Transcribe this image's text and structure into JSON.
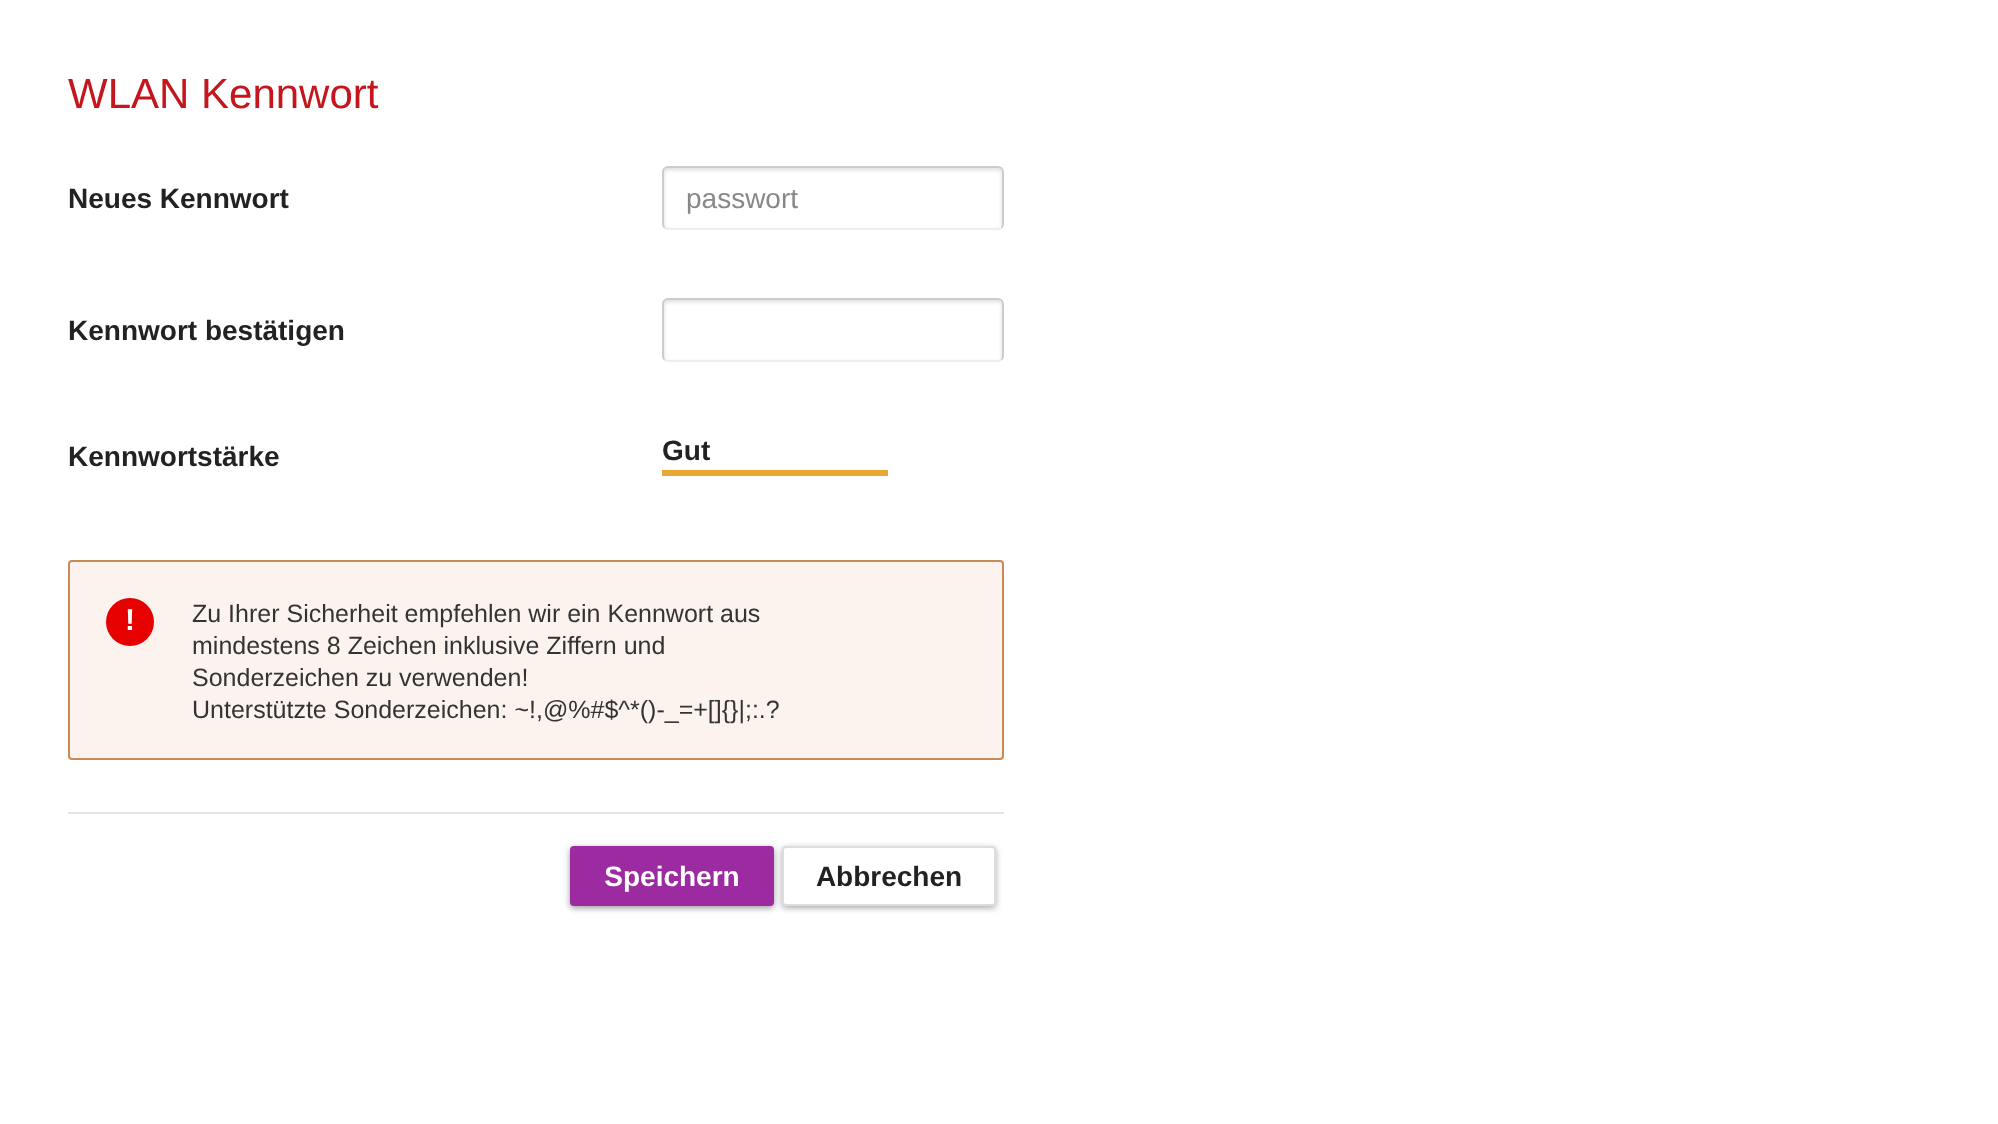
{
  "title": "WLAN Kennwort",
  "fields": [
    {
      "label": "Neues Kennwort",
      "placeholder": "passwort"
    },
    {
      "label": "Kennwort bestätigen"
    }
  ],
  "strength": {
    "label": "Kennwortstärke",
    "value": "Gut",
    "color": "#e8a833"
  },
  "alert": {
    "icon": "!",
    "text": "Zu Ihrer Sicherheit empfehlen wir ein Kennwort aus\nmindestens 8 Zeichen inklusive Ziffern und\nSonderzeichen zu verwenden!\nUnterstützte Sonderzeichen: ~!,@%#$^*()-_=+[]{}|;:.?"
  },
  "buttons": [
    {
      "label": "Speichern",
      "kind": "primary"
    },
    {
      "label": "Abbrechen",
      "kind": "secondary"
    }
  ]
}
